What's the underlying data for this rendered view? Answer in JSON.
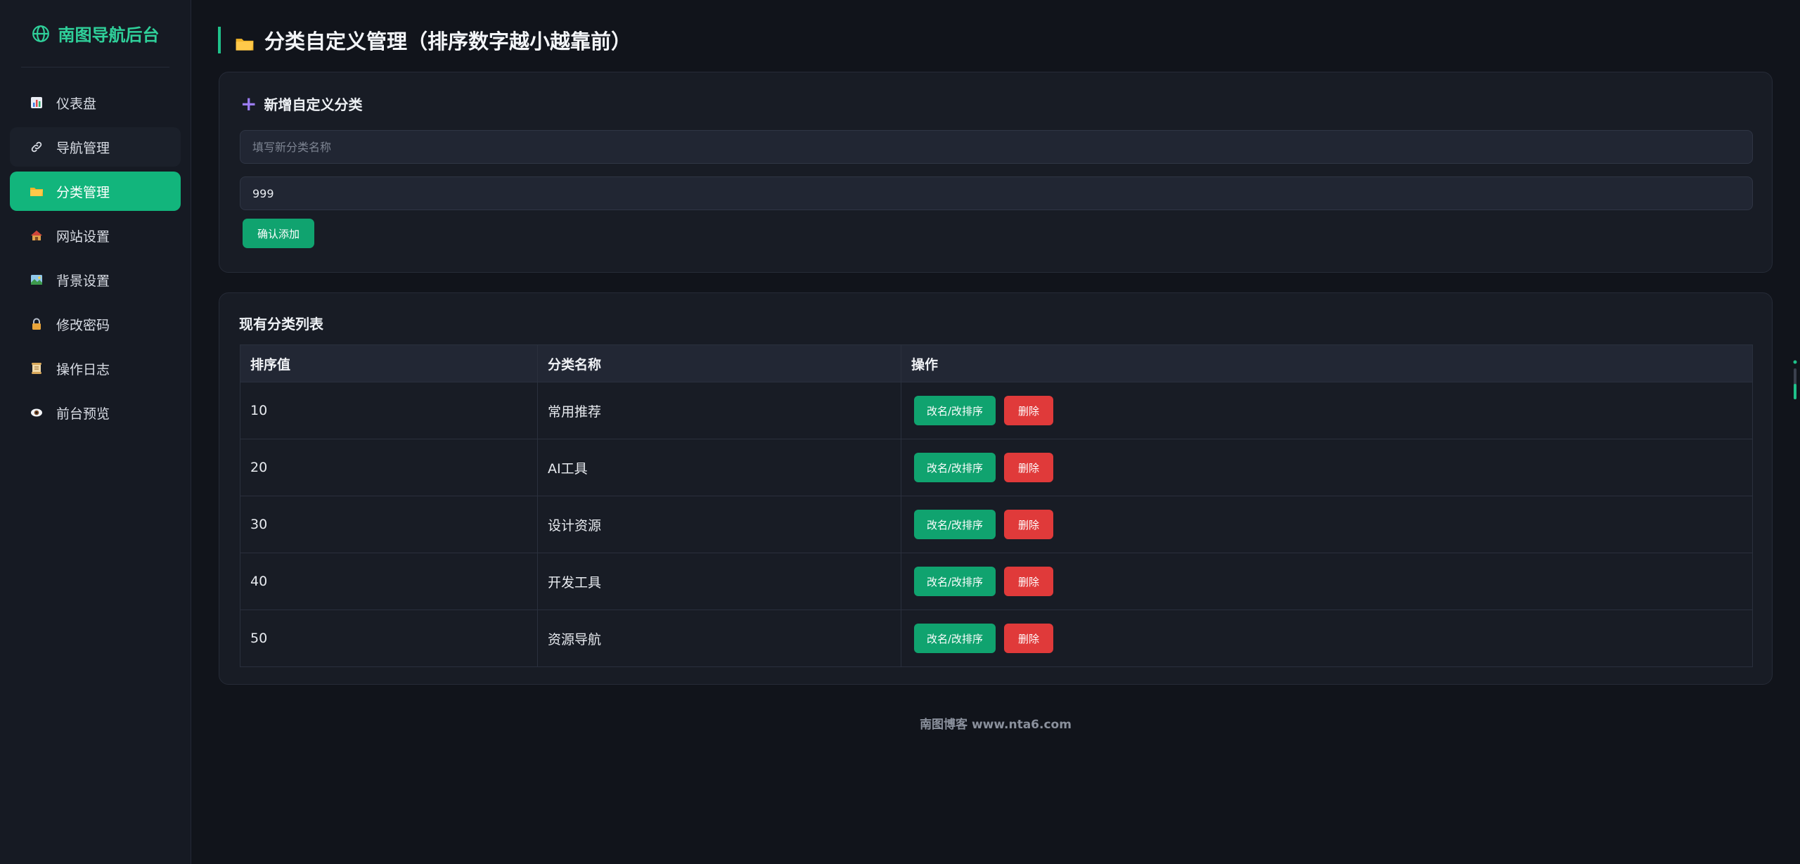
{
  "sidebar": {
    "brand": "南图导航后台",
    "items": [
      {
        "label": "仪表盘",
        "icon": "bar-chart-icon"
      },
      {
        "label": "导航管理",
        "icon": "link-icon"
      },
      {
        "label": "分类管理",
        "icon": "folder-icon"
      },
      {
        "label": "网站设置",
        "icon": "house-icon"
      },
      {
        "label": "背景设置",
        "icon": "picture-icon"
      },
      {
        "label": "修改密码",
        "icon": "lock-icon"
      },
      {
        "label": "操作日志",
        "icon": "scroll-icon"
      },
      {
        "label": "前台预览",
        "icon": "eye-icon"
      }
    ],
    "active_index": 2
  },
  "page": {
    "title": "分类自定义管理（排序数字越小越靠前）"
  },
  "add_form": {
    "heading": "新增自定义分类",
    "name_placeholder": "填写新分类名称",
    "name_value": "",
    "sort_value": "999",
    "submit_label": "确认添加"
  },
  "list": {
    "heading": "现有分类列表",
    "columns": [
      "排序值",
      "分类名称",
      "操作"
    ],
    "rows": [
      {
        "sort": "10",
        "name": "常用推荐"
      },
      {
        "sort": "20",
        "name": "AI工具"
      },
      {
        "sort": "30",
        "name": "设计资源"
      },
      {
        "sort": "40",
        "name": "开发工具"
      },
      {
        "sort": "50",
        "name": "资源导航"
      }
    ],
    "edit_label": "改名/改排序",
    "delete_label": "删除"
  },
  "footer": {
    "text": "南图博客 www.nta6.com"
  },
  "colors": {
    "accent": "#12b57c",
    "danger": "#e03a3a",
    "brand": "#2fd09a",
    "background": "#11141b"
  }
}
